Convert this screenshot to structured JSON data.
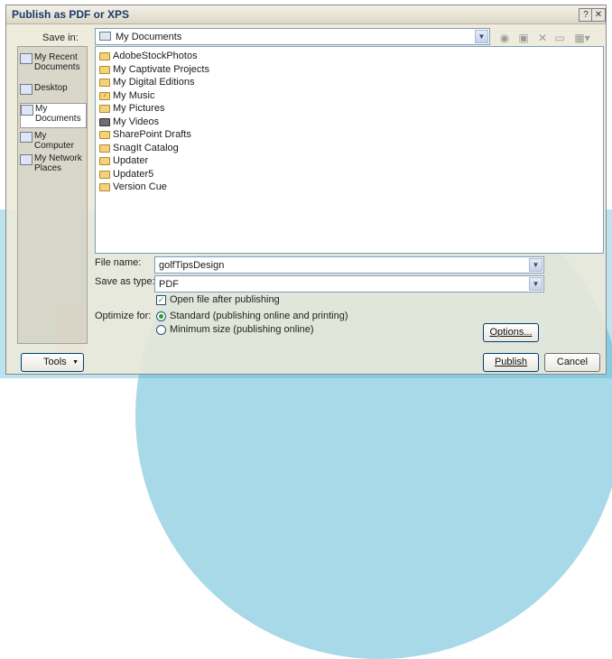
{
  "dialog": {
    "title": "Publish as PDF or XPS",
    "help_glyph": "?",
    "close_glyph": "✕"
  },
  "save_in": {
    "label": "Save in:",
    "value": "My Documents"
  },
  "toolbar_icons": [
    "back-icon",
    "up-folder-icon",
    "delete-icon",
    "new-folder-icon",
    "views-icon"
  ],
  "places": [
    {
      "label": "My Recent Documents",
      "icon": "recent-documents-icon",
      "selected": false
    },
    {
      "label": "Desktop",
      "icon": "desktop-icon",
      "selected": false
    },
    {
      "label": "My Documents",
      "icon": "my-documents-icon",
      "selected": true
    },
    {
      "label": "My Computer",
      "icon": "my-computer-icon",
      "selected": false
    },
    {
      "label": "My Network Places",
      "icon": "network-places-icon",
      "selected": false
    }
  ],
  "files": [
    "AdobeStockPhotos",
    "My Captivate Projects",
    "My Digital Editions",
    "My Music",
    "My Pictures",
    "My Videos",
    "SharePoint Drafts",
    "SnagIt Catalog",
    "Updater",
    "Updater5",
    "Version Cue"
  ],
  "file_name": {
    "label": "File name:",
    "value": "golfTipsDesign"
  },
  "save_as_type": {
    "label": "Save as type:",
    "value": "PDF"
  },
  "open_after": {
    "label": "Open file after publishing",
    "checked": true
  },
  "optimize": {
    "label": "Optimize for:",
    "standard": "Standard (publishing online and printing)",
    "minimum": "Minimum size (publishing online)",
    "selected": "standard"
  },
  "buttons": {
    "options": "Options...",
    "tools": "Tools",
    "publish": "Publish",
    "cancel": "Cancel"
  }
}
